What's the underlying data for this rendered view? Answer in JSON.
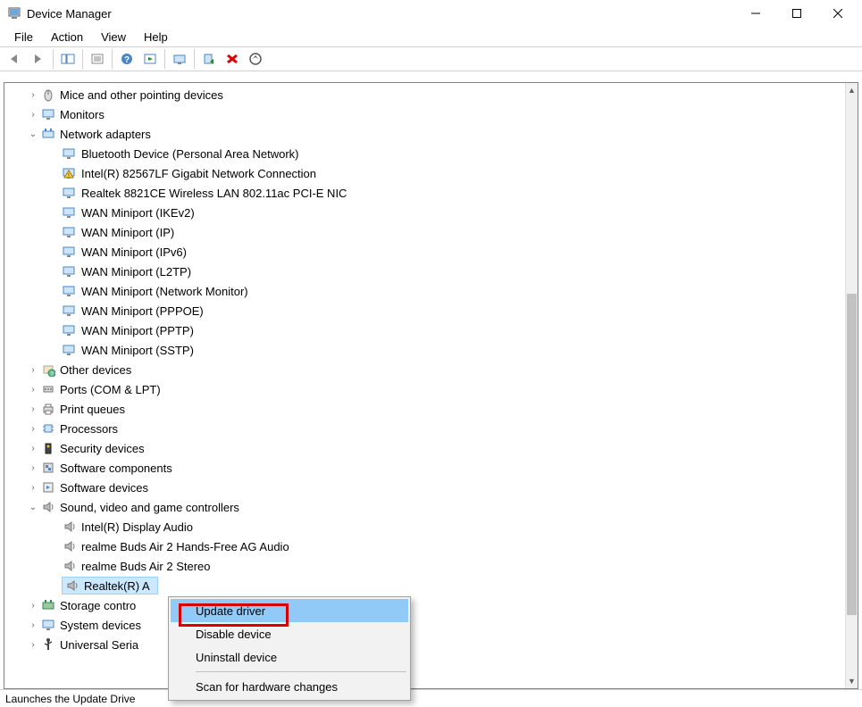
{
  "window": {
    "title": "Device Manager"
  },
  "menu": {
    "file": "File",
    "action": "Action",
    "view": "View",
    "help": "Help"
  },
  "tree": {
    "mice": "Mice and other pointing devices",
    "monitors": "Monitors",
    "network": "Network adapters",
    "net_children": [
      "Bluetooth Device (Personal Area Network)",
      "Intel(R) 82567LF Gigabit Network Connection",
      "Realtek 8821CE Wireless LAN 802.11ac PCI-E NIC",
      "WAN Miniport (IKEv2)",
      "WAN Miniport (IP)",
      "WAN Miniport (IPv6)",
      "WAN Miniport (L2TP)",
      "WAN Miniport (Network Monitor)",
      "WAN Miniport (PPPOE)",
      "WAN Miniport (PPTP)",
      "WAN Miniport (SSTP)"
    ],
    "other": "Other devices",
    "ports": "Ports (COM & LPT)",
    "printqueues": "Print queues",
    "processors": "Processors",
    "security": "Security devices",
    "softcomp": "Software components",
    "softdev": "Software devices",
    "sound": "Sound, video and game controllers",
    "sound_children": [
      "Intel(R) Display Audio",
      "realme Buds Air 2 Hands-Free AG Audio",
      "realme Buds Air 2 Stereo",
      "Realtek(R) A"
    ],
    "storage": "Storage contro",
    "sysdev": "System devices",
    "usb": "Universal Seria"
  },
  "context_menu": {
    "update": "Update driver",
    "disable": "Disable device",
    "uninstall": "Uninstall device",
    "scan": "Scan for hardware changes"
  },
  "statusbar": "Launches the Update Drive"
}
